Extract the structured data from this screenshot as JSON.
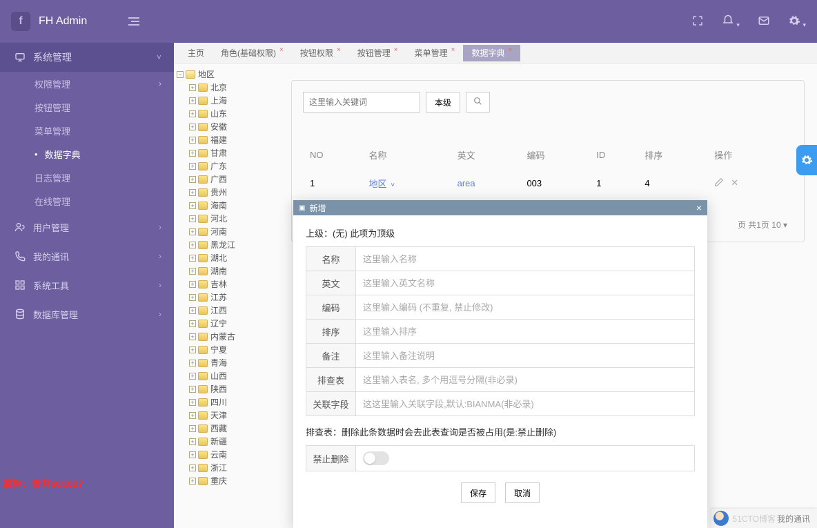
{
  "brand": "FH Admin",
  "topIcons": [
    "fullscreen",
    "bell",
    "mail",
    "gear"
  ],
  "sidebar": {
    "sections": [
      {
        "icon": "monitor",
        "label": "系统管理",
        "open": true,
        "subs": [
          {
            "label": "权限管理",
            "chev": true
          },
          {
            "label": "按钮管理"
          },
          {
            "label": "菜单管理"
          },
          {
            "label": "数据字典",
            "active": true
          },
          {
            "label": "日志管理"
          },
          {
            "label": "在线管理"
          }
        ]
      },
      {
        "icon": "users",
        "label": "用户管理",
        "chev": true
      },
      {
        "icon": "phone",
        "label": "我的通讯",
        "chev": true
      },
      {
        "icon": "grid",
        "label": "系统工具",
        "chev": true
      },
      {
        "icon": "db",
        "label": "数据库管理",
        "chev": true
      }
    ]
  },
  "watermark": "掌柜：青苔901027",
  "tabs": [
    {
      "label": "主页"
    },
    {
      "label": "角色(基础权限)",
      "closable": true
    },
    {
      "label": "按钮权限",
      "closable": true
    },
    {
      "label": "按钮管理",
      "closable": true
    },
    {
      "label": "菜单管理",
      "closable": true
    },
    {
      "label": "数据字典",
      "closable": true,
      "active": true
    }
  ],
  "tree": {
    "root": "地区",
    "children": [
      "北京",
      "上海",
      "山东",
      "安徽",
      "福建",
      "甘肃",
      "广东",
      "广西",
      "贵州",
      "海南",
      "河北",
      "河南",
      "黑龙江",
      "湖北",
      "湖南",
      "吉林",
      "江苏",
      "江西",
      "辽宁",
      "内蒙古",
      "宁夏",
      "青海",
      "山西",
      "陕西",
      "四川",
      "天津",
      "西藏",
      "新疆",
      "云南",
      "浙江",
      "重庆"
    ]
  },
  "filter": {
    "placeholder": "这里输入关键词",
    "level": "本级"
  },
  "table": {
    "headers": [
      "NO",
      "名称",
      "英文",
      "编码",
      "ID",
      "排序",
      "操作"
    ],
    "row": {
      "no": "1",
      "name": "地区",
      "en": "area",
      "code": "003",
      "id": "1",
      "order": "4"
    }
  },
  "pager": "页 共1页 10 ▾",
  "modal": {
    "title": "新增",
    "topNote": "上级：(无) 此项为顶级",
    "fields": [
      {
        "label": "名称",
        "placeholder": "这里输入名称"
      },
      {
        "label": "英文",
        "placeholder": "这里输入英文名称"
      },
      {
        "label": "编码",
        "placeholder": "这里输入编码 (不重复, 禁止修改)"
      },
      {
        "label": "排序",
        "placeholder": "这里输入排序"
      },
      {
        "label": "备注",
        "placeholder": "这里输入备注说明"
      },
      {
        "label": "排查表",
        "placeholder": "这里输入表名, 多个用逗号分隔(非必录)"
      },
      {
        "label": "关联字段",
        "placeholder": "这这里输入关联字段,默认:BIANMA(非必录)"
      }
    ],
    "hint": "排查表：删除此条数据时会去此表查询是否被占用(是:禁止删除)",
    "switchLabel": "禁止删除",
    "save": "保存",
    "cancel": "取消"
  },
  "footerChip": {
    "faint": "51CTO博客",
    "label": "我的通讯"
  }
}
